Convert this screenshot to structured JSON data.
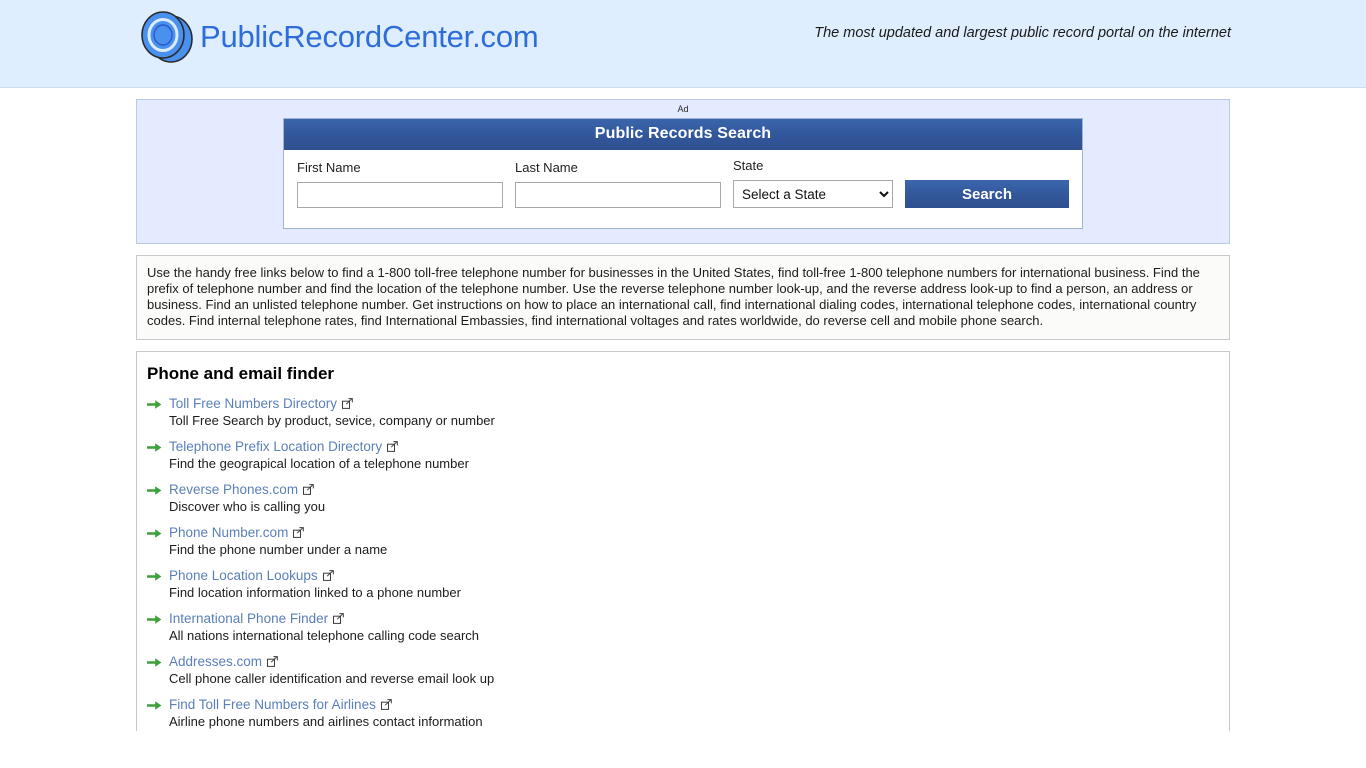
{
  "header": {
    "brand_name": "PublicRecordCenter.com",
    "logo_icon": "overlapping-circles-logo",
    "tagline": "The most updated and largest public record portal on the internet",
    "brand_color": "#2f6ddb",
    "background_color": "#deeeff"
  },
  "ad_panel": {
    "label": "Ad",
    "accent_color": "#32569a",
    "background_color": "#e4eaff"
  },
  "search_widget": {
    "title": "Public Records Search",
    "fields": [
      {
        "label": "First Name",
        "value": "",
        "placeholder": "",
        "name": "first-name"
      },
      {
        "label": "Last Name",
        "value": "",
        "placeholder": "",
        "name": "last-name"
      }
    ],
    "state": {
      "label": "State",
      "selected": "Select a State",
      "options": [
        "Select a State"
      ]
    },
    "submit_label": "Search"
  },
  "description": {
    "text": "Use the handy free links below to find a 1-800 toll-free telephone number for businesses in the United States, find toll-free 1-800 telephone numbers for international business. Find the prefix of telephone number and find the location of the telephone number. Use the reverse telephone number look-up, and the reverse address look-up to find a person, an address or business. Find an unlisted telephone number. Get instructions on how to place an international call, find international dialing codes, international telephone codes, international country codes. Find internal telephone rates, find International Embassies, find international voltages and rates worldwide, do reverse cell and mobile phone search."
  },
  "links_panel": {
    "title": "Phone and email finder",
    "bullet_icon": "green-arrow-icon",
    "external_icon": "external-link-icon",
    "link_color": "#5a7fba",
    "items": [
      {
        "label": "Toll Free Numbers Directory",
        "description": "Toll Free Search by product, sevice, company or number"
      },
      {
        "label": "Telephone Prefix Location Directory",
        "description": "Find the geograpical location of a telephone number"
      },
      {
        "label": "Reverse Phones.com",
        "description": "Discover who is calling you"
      },
      {
        "label": "Phone Number.com",
        "description": "Find the phone number under a name"
      },
      {
        "label": "Phone Location Lookups",
        "description": "Find location information linked to a phone number"
      },
      {
        "label": "International Phone Finder",
        "description": "All nations international telephone calling code search"
      },
      {
        "label": "Addresses.com",
        "description": "Cell phone caller identification and reverse email look up"
      },
      {
        "label": "Find Toll Free Numbers for Airlines",
        "description": "Airline phone numbers and airlines contact information"
      }
    ]
  }
}
